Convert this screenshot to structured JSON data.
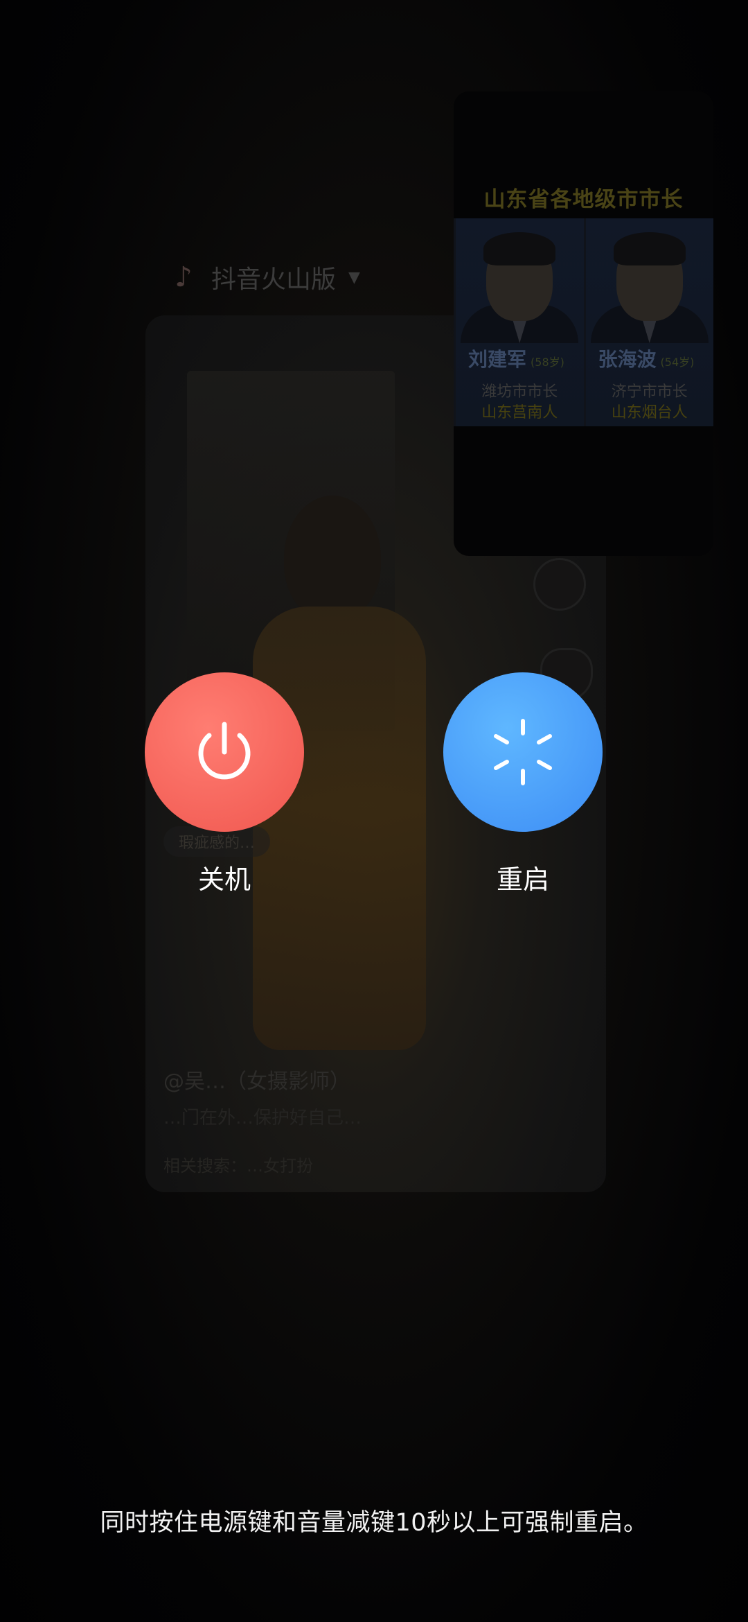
{
  "background_app": {
    "app_name": "抖音火山版",
    "app_icon": "tiktok-logo-icon",
    "video_tag": "瑕疵感的…",
    "caption_title": "@吴…（女摄影师）",
    "caption_sub": "…门在外…保护好自己…",
    "search_hint": "相关搜索：…女打扮"
  },
  "news_card": {
    "title": "山东省各地级市市长",
    "people": [
      {
        "name": "刘建军",
        "age": "(58岁)",
        "role": "潍坊市市长",
        "native": "山东莒南人"
      },
      {
        "name": "张海波",
        "age": "(54岁)",
        "role": "济宁市市长",
        "native": "山东烟台人"
      }
    ]
  },
  "power_menu": {
    "shutdown_label": "关机",
    "restart_label": "重启",
    "shutdown_icon": "power-icon",
    "restart_icon": "restart-icon",
    "shutdown_color": "#f25a51",
    "restart_color": "#4a9af7",
    "hint": "同时按住电源键和音量减键10秒以上可强制重启。"
  }
}
